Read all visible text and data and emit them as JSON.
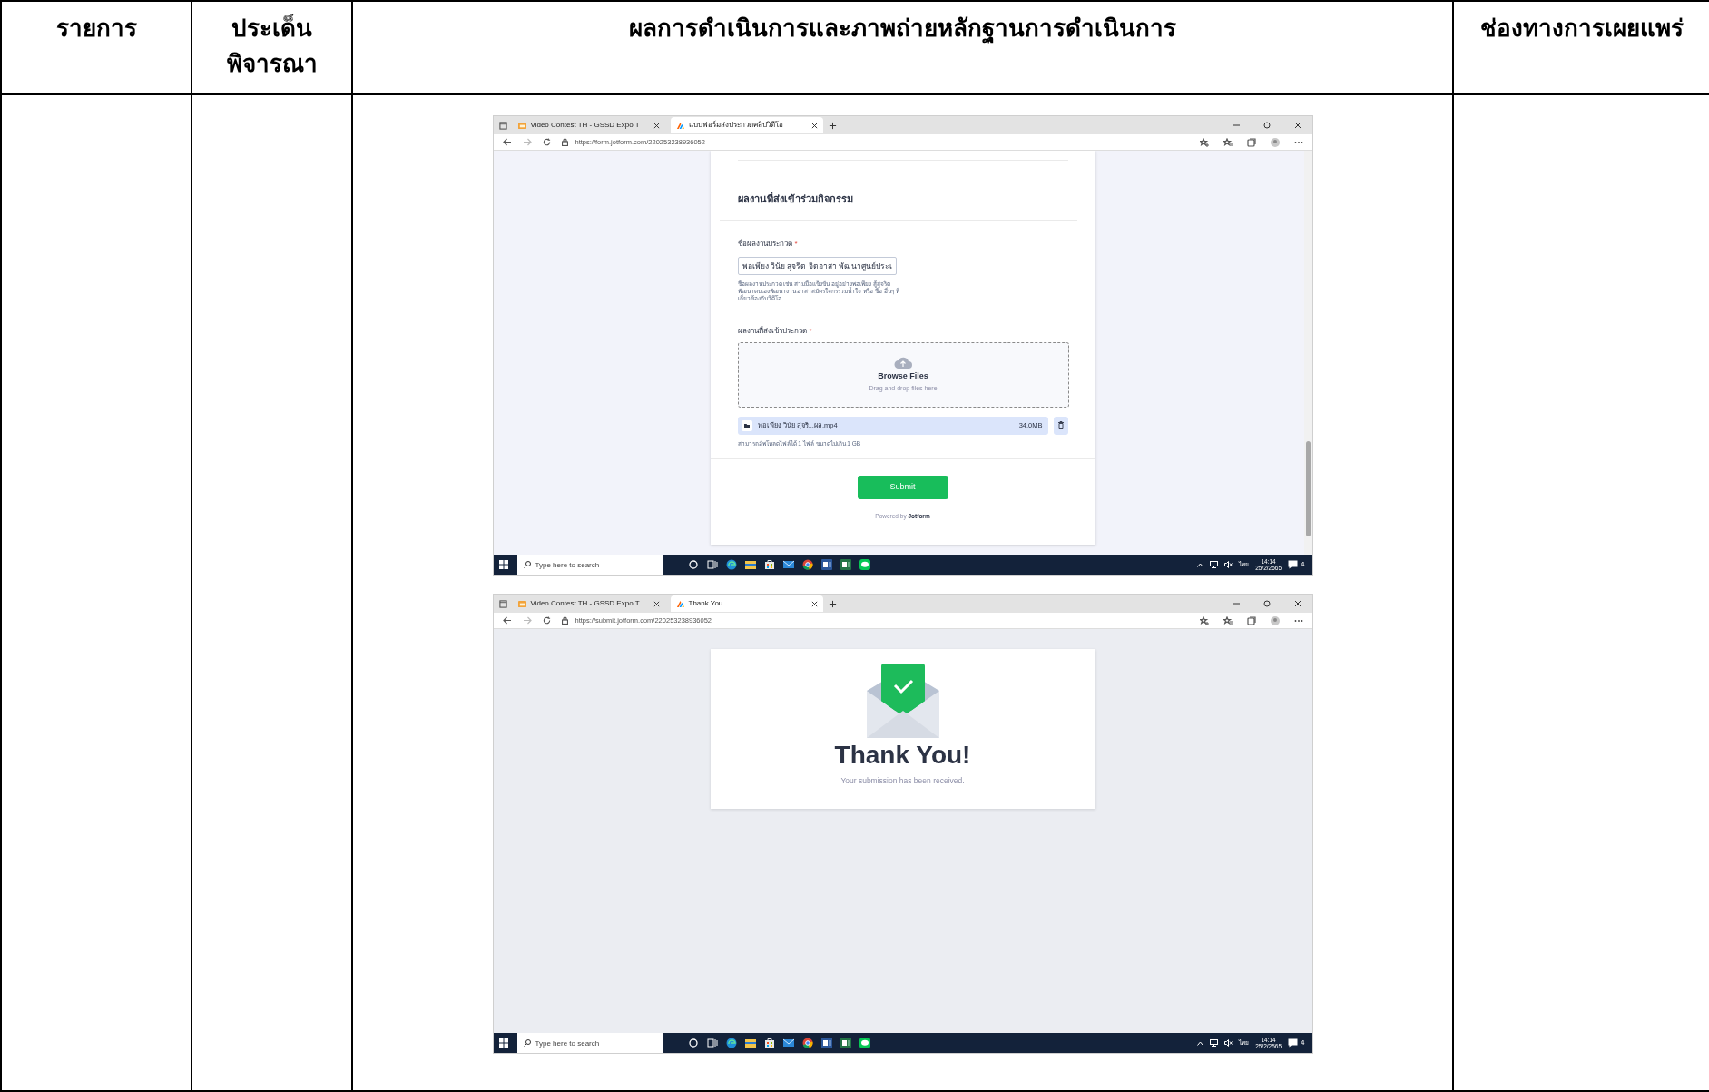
{
  "table": {
    "columns": [
      "รายการ",
      "ประเด็น พิจารณา",
      "ผลการดำเนินการและภาพถ่ายหลักฐานการดำเนินการ",
      "ช่องทางการเผยแพร่"
    ],
    "screenshots": [
      {
        "browser": {
          "tabs": [
            {
              "title": "Video Contest TH - GSSD Expo T",
              "selected": false
            },
            {
              "title": "แบบฟอร์มส่งประกวดคลิปวิดีโอ",
              "selected": true
            }
          ],
          "url": "https://form.jotform.com/220253238936052"
        },
        "page": {
          "kind": "form",
          "section_title": "ผลงานที่ส่งเข้าร่วมกิจกรรม",
          "name_field": {
            "label": "ชื่อผลงานประกวด",
            "required_mark": "*",
            "value": "พอเพียง วินัย สุจริต จิตอาสา พัฒนาศูนย์ประเ",
            "help": "ชื่อผลงานประกวด เช่น สามมือแข็งขัน อยู่อย่างพอเพียง สู้สุจริต พัฒนาตนเองพัฒนางาน อาสาสมัครใจกรรวมน้ำใจ หรือ ชื่อ อื่นๆ ที่เกี่ยวข้องกับวีดีโอ"
          },
          "upload_field": {
            "label": "ผลงานที่ส่งเข้าประกวด",
            "required_mark": "*",
            "title": "Browse Files",
            "subtitle": "Drag and drop files here",
            "file_name": "พอเพียง วินัย สุจริ...ผล.mp4",
            "file_size": "34.0MB",
            "help": "สามารถอัพโหลดไฟล์ได้ 1 ไฟล์ ขนาดไม่เกิน 1 GB"
          },
          "submit": "Submit",
          "footer": "Powered by **Jotform**"
        },
        "taskbar": {
          "search_placeholder": "Type here to search",
          "language": "ไทย",
          "time": "14:14",
          "date": "25/2/2565",
          "notifications": "4"
        }
      },
      {
        "browser": {
          "tabs": [
            {
              "title": "Video Contest TH - GSSD Expo T",
              "selected": false
            },
            {
              "title": "Thank You",
              "selected": true
            }
          ],
          "url": "https://submit.jotform.com/220253238936052"
        },
        "page": {
          "kind": "thanks",
          "title": "Thank You!",
          "message": "Your submission has been received."
        },
        "taskbar": {
          "search_placeholder": "Type here to search",
          "language": "ไทย",
          "time": "14:14",
          "date": "25/2/2565",
          "notifications": "4"
        }
      }
    ]
  }
}
